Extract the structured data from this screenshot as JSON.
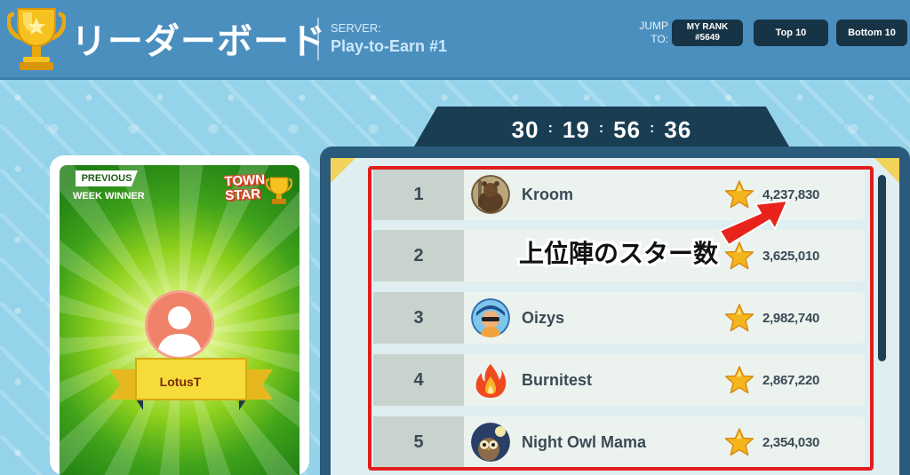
{
  "header": {
    "title": "リーダーボード",
    "server_label": "SERVER:",
    "server_name": "Play-to-Earn #1",
    "jump_label_line1": "JUMP",
    "jump_label_line2": "TO:",
    "my_rank_label": "MY RANK",
    "my_rank_value": "#5649",
    "top10_label": "Top 10",
    "bottom10_label": "Bottom 10"
  },
  "winner_card": {
    "badge": "PREVIOUS",
    "subtitle": "WEEK WINNER",
    "logo_line1": "TOWN",
    "logo_line2": "STAR",
    "winner_name": "LotusT"
  },
  "timer": {
    "days": "30",
    "hours": "19",
    "minutes": "56",
    "seconds": "36",
    "separator": ":"
  },
  "leaderboard": {
    "rows": [
      {
        "rank": "1",
        "name": "Kroom",
        "score": "4,237,830",
        "avatar": "bear-avatar-icon"
      },
      {
        "rank": "2",
        "name": "",
        "score": "3,625,010",
        "avatar": "blank-avatar-icon"
      },
      {
        "rank": "3",
        "name": "Oizys",
        "score": "2,982,740",
        "avatar": "gamer-avatar-icon"
      },
      {
        "rank": "4",
        "name": "Burnitest",
        "score": "2,867,220",
        "avatar": "fire-avatar-icon"
      },
      {
        "rank": "5",
        "name": "Night Owl Mama",
        "score": "2,354,030",
        "avatar": "owl-avatar-icon"
      }
    ]
  },
  "annotation": {
    "caption": "上位陣のスター数"
  },
  "colors": {
    "header_bg": "#4b8fbf",
    "button_bg": "#173446",
    "board_bg": "#2a5b7b",
    "highlight": "#e21d1d",
    "star": "#f5b51d"
  }
}
